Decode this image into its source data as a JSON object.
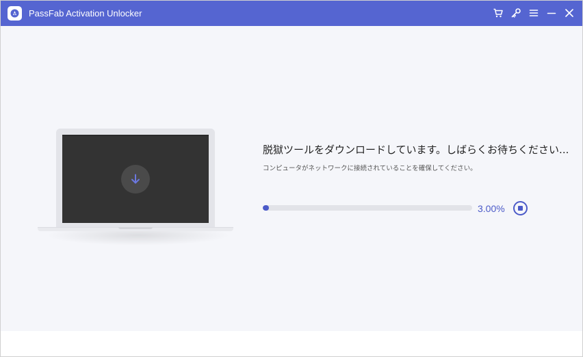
{
  "window": {
    "title": "PassFab Activation Unlocker"
  },
  "toolbar": {
    "icons": [
      "cart-icon",
      "key-icon",
      "menu-icon",
      "minimize-icon",
      "close-icon"
    ]
  },
  "main": {
    "message": "脱獄ツールをダウンロードしています。しばらくお待ちください...",
    "sub_message": "コンピュータがネットワークに接続されていることを確保してください。",
    "progress": {
      "percent": 3.0,
      "label": "3.00%"
    },
    "icons": [
      "download-arrow-icon",
      "stop-icon"
    ]
  },
  "colors": {
    "titlebar": "#5565d1",
    "accent": "#4b5ac8",
    "background": "#f5f6fa"
  }
}
